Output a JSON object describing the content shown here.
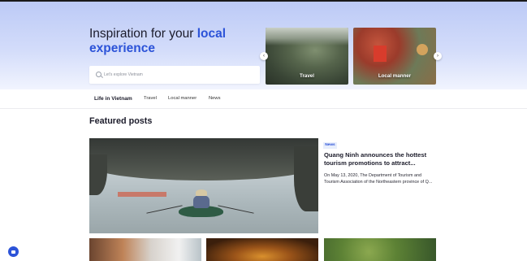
{
  "hero": {
    "title_plain": "Inspiration for your ",
    "title_accent_1": "local",
    "title_accent_2": "experience",
    "search_placeholder": "Let's explore Vietnam",
    "cards": [
      {
        "label": "Travel"
      },
      {
        "label": "Local manner"
      }
    ],
    "arrow_prev": "‹",
    "arrow_next": "›"
  },
  "nav": {
    "tabs": [
      "Life in Vietnam",
      "Travel",
      "Local manner",
      "News"
    ]
  },
  "featured": {
    "section_title": "Featured posts",
    "badge": "News",
    "post_title": "Quang Ninh announces the hottest tourism promotions to attract...",
    "post_excerpt": "On May 13, 2020, The Department of Tourism and Tourism Association of the Northeastern province of Q..."
  },
  "colors": {
    "accent": "#2c53d8",
    "hero_bg_top": "#bccaf6",
    "badge_bg": "#e8eefc"
  },
  "icons": {
    "search": "search-icon",
    "prev": "chevron-left-icon",
    "next": "chevron-right-icon",
    "chat": "chat-icon"
  }
}
